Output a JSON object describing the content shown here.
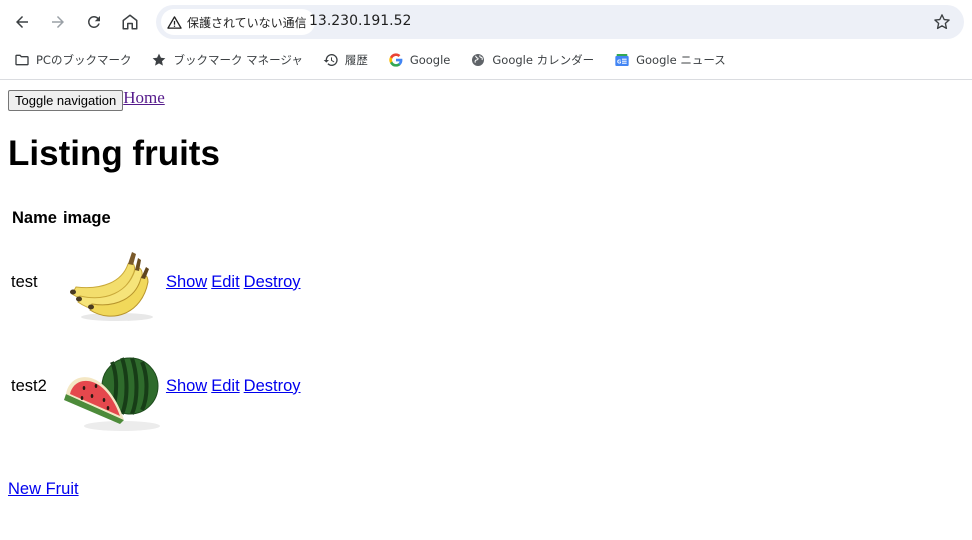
{
  "browser": {
    "security_label": "保護されていない通信",
    "url": "13.230.191.52",
    "bookmarks": [
      {
        "label": "PCのブックマーク",
        "icon": "folder-icon"
      },
      {
        "label": "ブックマーク マネージャ",
        "icon": "star-icon"
      },
      {
        "label": "履歴",
        "icon": "history-icon"
      },
      {
        "label": "Google",
        "icon": "google-icon"
      },
      {
        "label": "Google カレンダー",
        "icon": "globe-icon"
      },
      {
        "label": "Google ニュース",
        "icon": "google-news-icon"
      }
    ]
  },
  "nav": {
    "toggle_label": "Toggle navigation",
    "home_label": "Home"
  },
  "main": {
    "title": "Listing fruits",
    "columns": [
      "Name",
      "image"
    ],
    "rows": [
      {
        "name": "test",
        "image": "banana",
        "actions": [
          "Show",
          "Edit",
          "Destroy"
        ]
      },
      {
        "name": "test2",
        "image": "watermelon",
        "actions": [
          "Show",
          "Edit",
          "Destroy"
        ]
      }
    ],
    "new_label": "New Fruit"
  }
}
